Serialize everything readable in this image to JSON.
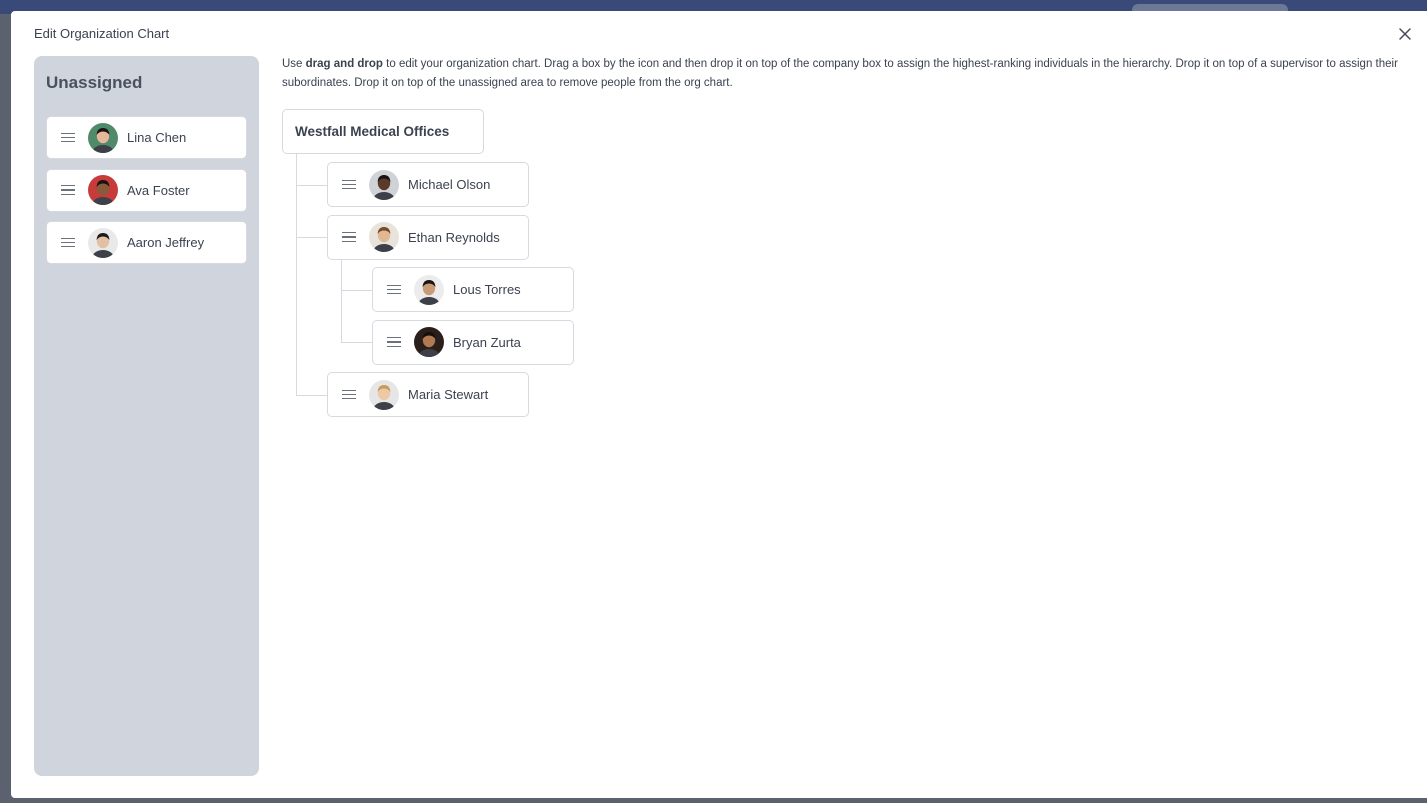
{
  "dialog": {
    "title": "Edit Organization Chart",
    "close_icon": "close-icon"
  },
  "unassigned": {
    "title": "Unassigned",
    "people": [
      {
        "name": "Lina Chen",
        "avatar_bg": "#4f8a6a",
        "skin": "#e6b79a",
        "hair": "#1d1512"
      },
      {
        "name": "Ava Foster",
        "avatar_bg": "#c73b3b",
        "skin": "#8a5a3c",
        "hair": "#1b120e"
      },
      {
        "name": "Aaron Jeffrey",
        "avatar_bg": "#e9e9e9",
        "skin": "#e2c0a4",
        "hair": "#1b1b1b"
      }
    ]
  },
  "instructions": {
    "prefix": "Use ",
    "bold": "drag and drop",
    "suffix": " to edit your organization chart. Drag a box by the icon and then drop it on top of the company box to assign the highest-ranking individuals in the hierarchy. Drop it on top of a supervisor to assign their subordinates. Drop it on top of the unassigned area to remove people from the org chart."
  },
  "org_chart": {
    "company": "Westfall Medical Offices",
    "members": [
      {
        "name": "Michael Olson",
        "level": 1,
        "avatar_bg": "#cfd3d8",
        "skin": "#5a3a28",
        "hair": "#1a1210"
      },
      {
        "name": "Ethan Reynolds",
        "level": 1,
        "avatar_bg": "#e8e4dc",
        "skin": "#e0b894",
        "hair": "#7a4a2a"
      },
      {
        "name": "Lous Torres",
        "level": 2,
        "avatar_bg": "#ececec",
        "skin": "#c99a76",
        "hair": "#1c1410"
      },
      {
        "name": "Bryan Zurta",
        "level": 2,
        "avatar_bg": "#2a1f1a",
        "skin": "#b07a52",
        "hair": "#15100c"
      },
      {
        "name": "Maria Stewart",
        "level": 1,
        "avatar_bg": "#e6e6e6",
        "skin": "#eccaa8",
        "hair": "#c99b5a"
      }
    ]
  },
  "icons": {
    "drag_handle": "drag-handle-icon"
  }
}
